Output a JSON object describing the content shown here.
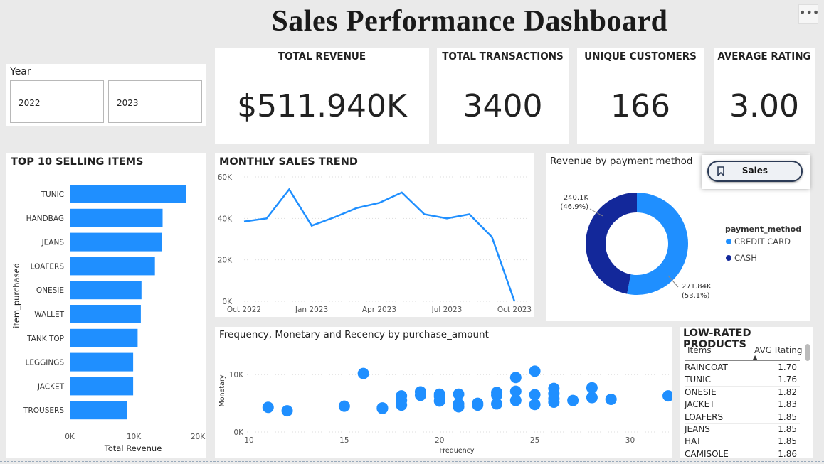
{
  "header": {
    "title": "Sales Performance Dashboard",
    "more_icon": "more-options-icon"
  },
  "slicer": {
    "label": "Year",
    "options": [
      "2022",
      "2023"
    ]
  },
  "kpis": [
    {
      "label": "TOTAL REVENUE",
      "value": "$511.940K"
    },
    {
      "label": "TOTAL TRANSACTIONS",
      "value": "3400"
    },
    {
      "label": "UNIQUE CUSTOMERS",
      "value": "166"
    },
    {
      "label": "AVERAGE RATING",
      "value": "3.00"
    }
  ],
  "bookmark_button": {
    "label": "Sales",
    "icon": "bookmark-icon"
  },
  "colors": {
    "bar": "#1f8fff",
    "line": "#1f8fff",
    "credit": "#1f8fff",
    "cash": "#13289a"
  },
  "chart_data": [
    {
      "type": "bar",
      "orientation": "horizontal",
      "title": "TOP 10 SELLING ITEMS",
      "ylabel": "item_purchased",
      "xlabel": "Total Revenue",
      "categories": [
        "TUNIC",
        "HANDBAG",
        "JEANS",
        "LOAFERS",
        "ONESIE",
        "WALLET",
        "TANK TOP",
        "LEGGINGS",
        "JACKET",
        "TROUSERS"
      ],
      "values": [
        18200,
        14500,
        14400,
        13300,
        11200,
        11100,
        10600,
        9900,
        9900,
        9000
      ],
      "xlim": [
        0,
        20000
      ],
      "xticks": [
        "0K",
        "10K",
        "20K"
      ]
    },
    {
      "type": "line",
      "title": "MONTHLY SALES TREND",
      "x": [
        "2022-10",
        "2022-11",
        "2022-12",
        "2023-01",
        "2023-02",
        "2023-03",
        "2023-04",
        "2023-05",
        "2023-06",
        "2023-07",
        "2023-08",
        "2023-09",
        "2023-10"
      ],
      "values": [
        38500,
        40000,
        54000,
        36500,
        40500,
        45000,
        47500,
        52500,
        42000,
        40000,
        42000,
        31000,
        0
      ],
      "ylim": [
        0,
        60000
      ],
      "yticks": [
        "0K",
        "20K",
        "40K",
        "60K"
      ],
      "xticks": [
        "Oct 2022",
        "Jan 2023",
        "Apr 2023",
        "Jul 2023",
        "Oct 2023"
      ]
    },
    {
      "type": "pie",
      "style": "donut",
      "title": "Revenue by payment method",
      "legend_title": "payment_method",
      "legend_position": "right",
      "slices": [
        {
          "name": "CREDIT CARD",
          "value": 271.84,
          "label": "271.84K",
          "pct": "(53.1%)"
        },
        {
          "name": "CASH",
          "value": 240.1,
          "label": "240.1K",
          "pct": "(46.9%)"
        }
      ]
    },
    {
      "type": "scatter",
      "title": "Frequency, Monetary and Recency by purchase_amount",
      "xlabel": "Frequency",
      "ylabel": "Monetary",
      "xlim": [
        10,
        32
      ],
      "ylim": [
        0,
        13000
      ],
      "xticks": [
        "10",
        "15",
        "20",
        "25",
        "30"
      ],
      "yticks": [
        "0K",
        "10K"
      ],
      "points": [
        [
          11,
          4300
        ],
        [
          12,
          3700
        ],
        [
          15,
          4500
        ],
        [
          16,
          10200
        ],
        [
          17,
          4200
        ],
        [
          17,
          4100
        ],
        [
          18,
          4700
        ],
        [
          18,
          5500
        ],
        [
          18,
          6300
        ],
        [
          19,
          6400
        ],
        [
          19,
          7000
        ],
        [
          20,
          5400
        ],
        [
          20,
          6200
        ],
        [
          20,
          6600
        ],
        [
          21,
          4400
        ],
        [
          21,
          4900
        ],
        [
          21,
          6600
        ],
        [
          22,
          4700
        ],
        [
          22,
          5000
        ],
        [
          23,
          4900
        ],
        [
          23,
          6400
        ],
        [
          23,
          6900
        ],
        [
          24,
          5500
        ],
        [
          24,
          7100
        ],
        [
          24,
          9500
        ],
        [
          25,
          4800
        ],
        [
          25,
          6500
        ],
        [
          25,
          10600
        ],
        [
          26,
          5200
        ],
        [
          26,
          5800
        ],
        [
          26,
          6700
        ],
        [
          26,
          7600
        ],
        [
          27,
          5500
        ],
        [
          28,
          6000
        ],
        [
          28,
          7700
        ],
        [
          29,
          5700
        ],
        [
          32,
          6300
        ]
      ]
    }
  ],
  "low_rated": {
    "title": "LOW-RATED PRODUCTS",
    "col_items": "Items",
    "col_rating": "AVG Rating",
    "rows": [
      {
        "item": "RAINCOAT",
        "rating": "1.70"
      },
      {
        "item": "TUNIC",
        "rating": "1.76"
      },
      {
        "item": "ONESIE",
        "rating": "1.82"
      },
      {
        "item": "JACKET",
        "rating": "1.83"
      },
      {
        "item": "LOAFERS",
        "rating": "1.85"
      },
      {
        "item": "JEANS",
        "rating": "1.85"
      },
      {
        "item": "HAT",
        "rating": "1.85"
      },
      {
        "item": "CAMISOLE",
        "rating": "1.86"
      }
    ]
  }
}
